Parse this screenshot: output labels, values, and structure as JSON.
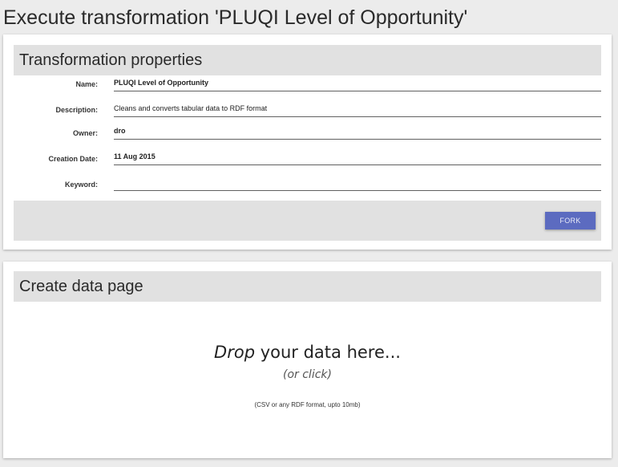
{
  "page": {
    "title": "Execute transformation 'PLUQI Level of Opportunity'"
  },
  "transformation_card": {
    "header": "Transformation properties",
    "properties": [
      {
        "label": "Name:",
        "value": "PLUQI Level of Opportunity"
      },
      {
        "label": "Description:",
        "value": "Cleans and converts tabular data to RDF format"
      },
      {
        "label": "Owner:",
        "value": "dro"
      },
      {
        "label": "Creation Date:",
        "value": "11 Aug 2015"
      },
      {
        "label": "Keyword:",
        "value": ""
      }
    ],
    "fork_label": "FORK"
  },
  "data_card": {
    "header": "Create data page",
    "drop_emphasis": "Drop",
    "drop_rest": " your data here...",
    "drop_sub": "(or click)",
    "drop_note": "(CSV or any RDF format, upto 10mb)"
  },
  "colors": {
    "background": "#ececec",
    "card": "#ffffff",
    "header_bar": "#e1e1e1",
    "accent_button": "#5c6bc0"
  }
}
